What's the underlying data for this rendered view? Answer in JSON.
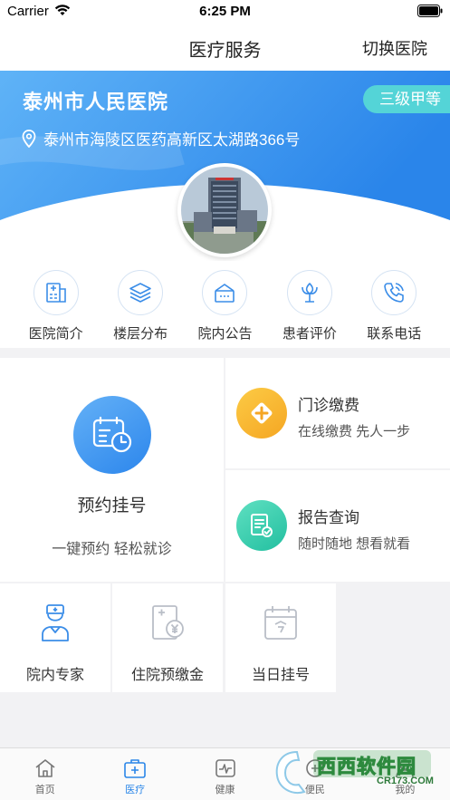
{
  "status": {
    "carrier": "Carrier",
    "time": "6:25 PM"
  },
  "nav": {
    "title": "医疗服务",
    "right_action": "切换医院"
  },
  "hospital": {
    "name": "泰州市人民医院",
    "grade": "三级甲等",
    "address": "泰州市海陵区医药高新区太湖路366号"
  },
  "quick_links": [
    {
      "label": "医院简介",
      "icon": "hospital-info-icon"
    },
    {
      "label": "楼层分布",
      "icon": "layers-icon"
    },
    {
      "label": "院内公告",
      "icon": "notice-icon"
    },
    {
      "label": "患者评价",
      "icon": "review-icon"
    },
    {
      "label": "联系电话",
      "icon": "phone-icon"
    }
  ],
  "services": {
    "appointment": {
      "title": "预约挂号",
      "subtitle": "一键预约 轻松就诊",
      "icon": "calendar-clock-icon"
    },
    "payment": {
      "title": "门诊缴费",
      "subtitle": "在线缴费 先人一步",
      "icon": "plus-diamond-icon"
    },
    "report": {
      "title": "报告查询",
      "subtitle": "随时随地 想看就看",
      "icon": "report-icon"
    },
    "experts": {
      "label": "院内专家",
      "icon": "doctor-icon"
    },
    "deposit": {
      "label": "住院预缴金",
      "icon": "deposit-icon"
    },
    "same_day": {
      "label": "当日挂号",
      "icon": "today-calendar-icon"
    }
  },
  "tabs": [
    {
      "label": "首页",
      "icon": "home-icon",
      "active": false
    },
    {
      "label": "医疗",
      "icon": "medical-kit-icon",
      "active": true
    },
    {
      "label": "健康",
      "icon": "heartbeat-icon",
      "active": false
    },
    {
      "label": "便民",
      "icon": "convenience-icon",
      "active": false
    },
    {
      "label": "我的",
      "icon": "profile-icon",
      "active": false
    }
  ],
  "watermark": {
    "text": "西西软件园",
    "url": "CR173.COM"
  },
  "colors": {
    "accent": "#2a86e8",
    "badge": "#54d4d7",
    "pay": "#f7b52b",
    "report": "#2fc9a6"
  }
}
